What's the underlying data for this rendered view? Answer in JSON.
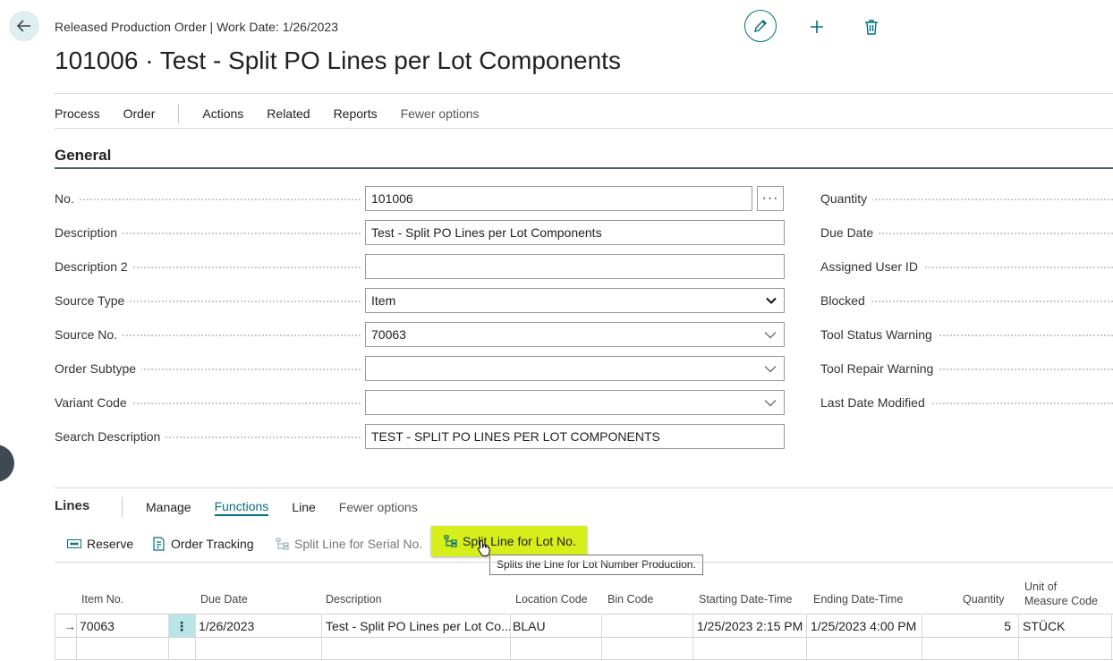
{
  "header": {
    "breadcrumb": "Released Production Order | Work Date: 1/26/2023",
    "title": "101006 · Test - Split PO Lines per Lot Components"
  },
  "menu": {
    "items": [
      "Process",
      "Order",
      "Actions",
      "Related",
      "Reports",
      "Fewer options"
    ]
  },
  "general": {
    "title": "General",
    "fields": [
      {
        "label": "No.",
        "value": "101006",
        "type": "text-assist"
      },
      {
        "label": "Description",
        "value": "Test - Split PO Lines per Lot Components",
        "type": "text"
      },
      {
        "label": "Description 2",
        "value": "",
        "type": "text"
      },
      {
        "label": "Source Type",
        "value": "Item",
        "type": "select"
      },
      {
        "label": "Source No.",
        "value": "70063",
        "type": "lookup"
      },
      {
        "label": "Order Subtype",
        "value": "",
        "type": "lookup"
      },
      {
        "label": "Variant Code",
        "value": "",
        "type": "lookup"
      },
      {
        "label": "Search Description",
        "value": "TEST - SPLIT PO LINES PER LOT COMPONENTS",
        "type": "text"
      }
    ],
    "right_fields": [
      "Quantity",
      "Due Date",
      "Assigned User ID",
      "Blocked",
      "Tool Status Warning",
      "Tool Repair Warning",
      "Last Date Modified"
    ]
  },
  "lines": {
    "title": "Lines",
    "tabs": [
      "Manage",
      "Functions",
      "Line",
      "Fewer options"
    ],
    "actions": [
      "Reserve",
      "Order Tracking",
      "Split Line for Serial No.",
      "Split Line for Lot No."
    ],
    "tooltip": "Splits the Line for Lot Number Production.",
    "columns": {
      "item_no": "Item No.",
      "due_date": "Due Date",
      "description": "Description",
      "location_code": "Location Code",
      "bin_code": "Bin Code",
      "starting": "Starting Date-Time",
      "ending": "Ending Date-Time",
      "quantity": "Quantity",
      "uom_1": "Unit of",
      "uom_2": "Measure Code"
    },
    "rows": [
      {
        "arrow": "→",
        "item_no": "70063",
        "due_date": "1/26/2023",
        "description": "Test - Split PO Lines per Lot Co...",
        "location_code": "BLAU",
        "bin_code": "",
        "starting": "1/25/2023 2:15 PM",
        "ending": "1/25/2023 4:00 PM",
        "quantity": "5",
        "uom": "STÜCK"
      }
    ]
  },
  "colors": {
    "accent": "#00707a",
    "highlight": "#d6ee1a"
  }
}
